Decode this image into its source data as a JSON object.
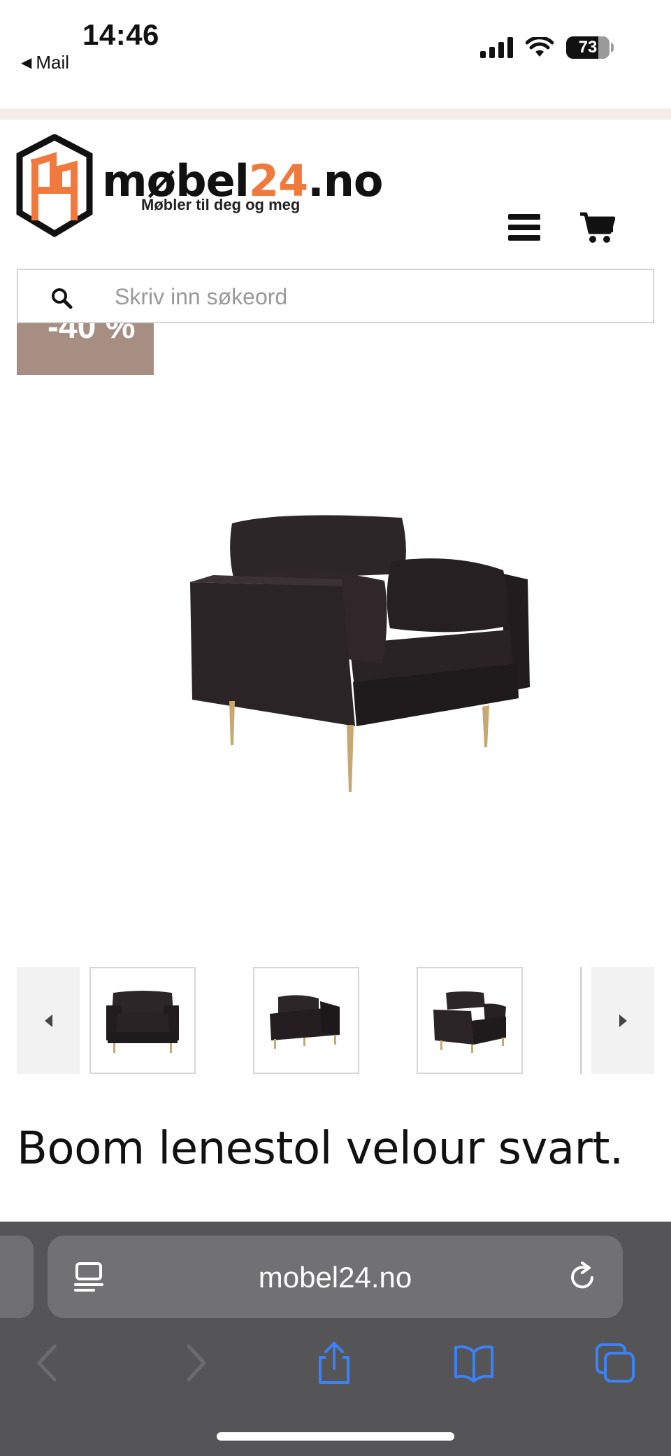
{
  "status_bar": {
    "time": "14:46",
    "back_label": "Mail",
    "battery": "73"
  },
  "header": {
    "logo_name_main": "møbel",
    "logo_name_accent": "24",
    "logo_name_suffix": ".no",
    "logo_tagline": "Møbler til deg og meg",
    "brand_accent_color": "#f07a3e",
    "menu_icon": "hamburger-icon",
    "cart_icon": "cart-icon"
  },
  "search": {
    "placeholder": "Skriv inn søkeord"
  },
  "product": {
    "discount_badge": "-40 %",
    "badge_color": "#a68f82",
    "title": "Boom lenestol velour svart."
  },
  "gallery": {
    "thumbnail_count": 3
  },
  "browser": {
    "url": "mobel24.no",
    "toolbar_accent": "#3b82f6"
  }
}
